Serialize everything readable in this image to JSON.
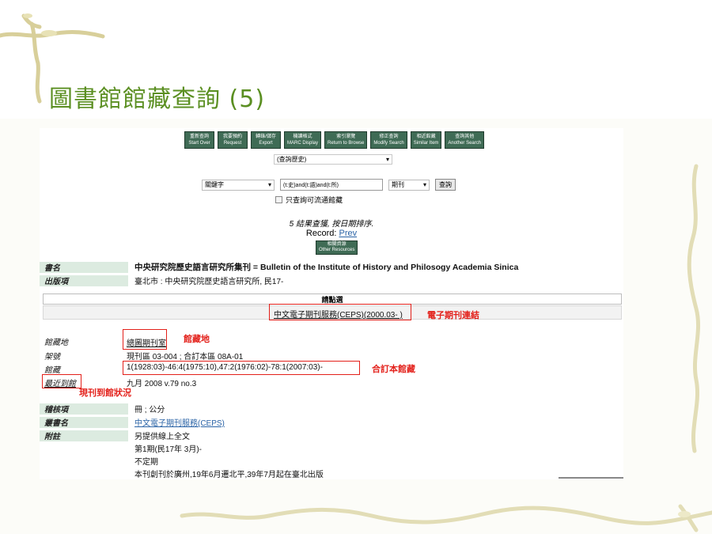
{
  "slide": {
    "title": "圖書館館藏查詢 (5)"
  },
  "toolbar": {
    "buttons": [
      {
        "zh": "重新查詢",
        "en": "Start Over"
      },
      {
        "zh": "我要預約",
        "en": "Request"
      },
      {
        "zh": "轉錄/儲存",
        "en": "Export"
      },
      {
        "zh": "機讀格式",
        "en": "MARC Display"
      },
      {
        "zh": "索引瀏覽",
        "en": "Return to Browse"
      },
      {
        "zh": "修正查詢",
        "en": "Modify Search"
      },
      {
        "zh": "相近館藏",
        "en": "Similar Item"
      },
      {
        "zh": "查詢其他",
        "en": "Another Search"
      }
    ]
  },
  "search": {
    "history_select": "(查詢歷史)",
    "field_select": "關鍵字",
    "query_value": "(t:史)and(t:語)and(t:所)",
    "type_select": "期刊",
    "go_label": "查詢",
    "available_only": "只查詢可流通館藏"
  },
  "results": {
    "summary": "5 結果查獲, 按日期排序.",
    "record_label": "Record:",
    "prev_label": "Prev",
    "other_resources_zh": "相關資源",
    "other_resources_en": "Other Resources"
  },
  "record": {
    "title_label": "書名",
    "title_value": "中央研究院歷史語言研究所集刊 = Bulletin of the Institute of History and Philosogy Academia Sinica",
    "pub_label": "出版項",
    "pub_value": "臺北市 : 中央研究院歷史語言研究所, 民17-",
    "please_select": "請點選",
    "ceps_link": "中文電子期刊服務(CEPS)(2000.03- )",
    "location_label": "館藏地",
    "location_value": "總圖期刊室",
    "callno_label": "架號",
    "callno_value": "現刊區 03-004 ; 合訂本區 08A-01",
    "holdings_label": "館藏",
    "holdings_value": "1(1928:03)-46:4(1975:10),47:2(1976:02)-78:1(2007:03)-",
    "latest_label": "最近到館",
    "latest_value": "九月 2008 v.79 no.3",
    "phys_label": "稽核項",
    "phys_value": "冊 ; 公分",
    "series_label": "叢書名",
    "series_value": "中文電子期刊服務(CEPS)",
    "notes_label": "附註",
    "notes": [
      "另提供線上全文",
      "第1期(民17年 3月)-",
      "不定期",
      "本刊創刊於廣州,19年6月遷北平,39年7月起在臺北出版"
    ]
  },
  "annotations": {
    "ejournal": "電子期刊連結",
    "location": "館藏地",
    "bound": "合訂本館藏",
    "current_status": "現刊到館狀況"
  },
  "colors": {
    "title_green": "#5b8f22",
    "button_green": "#3f6b55",
    "annotation_red": "#e3201a",
    "label_bg": "#dcebe0"
  }
}
